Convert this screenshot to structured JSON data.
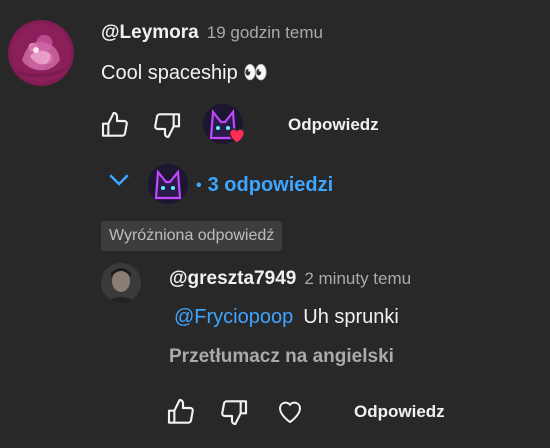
{
  "comment": {
    "author": "@Leymora",
    "time": "19 godzin temu",
    "text": "Cool spaceship 👀",
    "reply_label": "Odpowiedz"
  },
  "replies": {
    "separator": "•",
    "count_label": "3 odpowiedzi"
  },
  "highlighted_badge": "Wyróżniona odpowiedź",
  "reply": {
    "author": "@greszta7949",
    "time": "2 minuty temu",
    "mention": "@Fryciopoop",
    "text": "Uh sprunki",
    "translate_label": "Przetłumacz na angielski",
    "reply_label": "Odpowiedz"
  },
  "colors": {
    "background": "#282828",
    "link": "#3ea6ff",
    "heart": "#ff2d55"
  }
}
